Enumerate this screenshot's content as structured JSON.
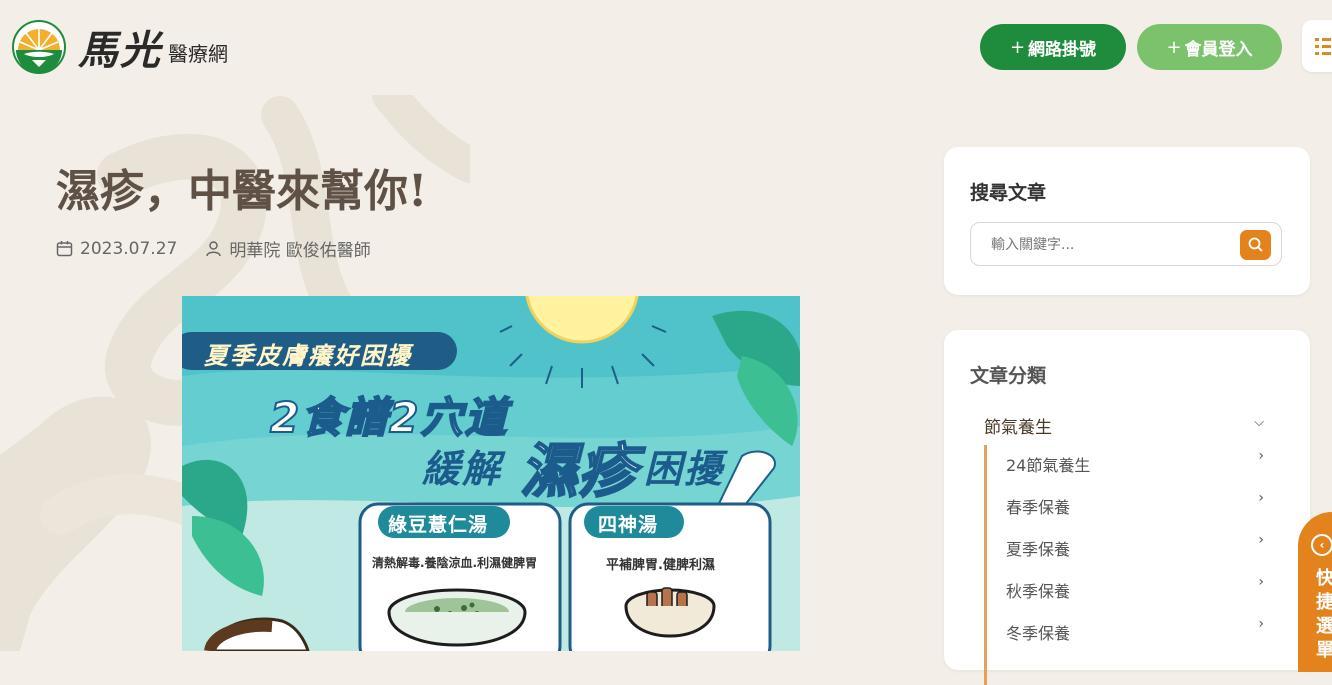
{
  "header": {
    "brand": "馬光",
    "brand_sub": "醫療網",
    "register_label": "網路掛號",
    "login_label": "會員登入",
    "plus": "+",
    "menu_icon": "list-icon"
  },
  "article": {
    "title": "濕疹，中醫來幫你!",
    "date": "2023.07.27",
    "author": "明華院 歐俊佑醫師"
  },
  "poster": {
    "tag": "夏季皮膚癢好困擾",
    "headline1": "2食譜2穴道",
    "headline2a": "緩解",
    "headline2b": "濕疹",
    "headline2c": "困擾",
    "card1_title": "綠豆薏仁湯",
    "card1_desc": "清熱解毒.養陰涼血.利濕健脾胃",
    "card2_title": "四神湯",
    "card2_desc": "平補脾胃.健脾利濕"
  },
  "sidebar": {
    "search_title": "搜尋文章",
    "search_placeholder": "輸入關鍵字...",
    "category_title": "文章分類",
    "category_parent": "節氣養生",
    "categories": [
      "24節氣養生",
      "春季保養",
      "夏季保養",
      "秋季保養",
      "冬季保養"
    ]
  },
  "quick_tab": {
    "label": "快捷選單"
  },
  "colors": {
    "primary_green": "#1e8c3c",
    "light_green": "#7cc26c",
    "accent_orange": "#e3831d",
    "background": "#f3efe8",
    "title_brown": "#5f5145"
  }
}
